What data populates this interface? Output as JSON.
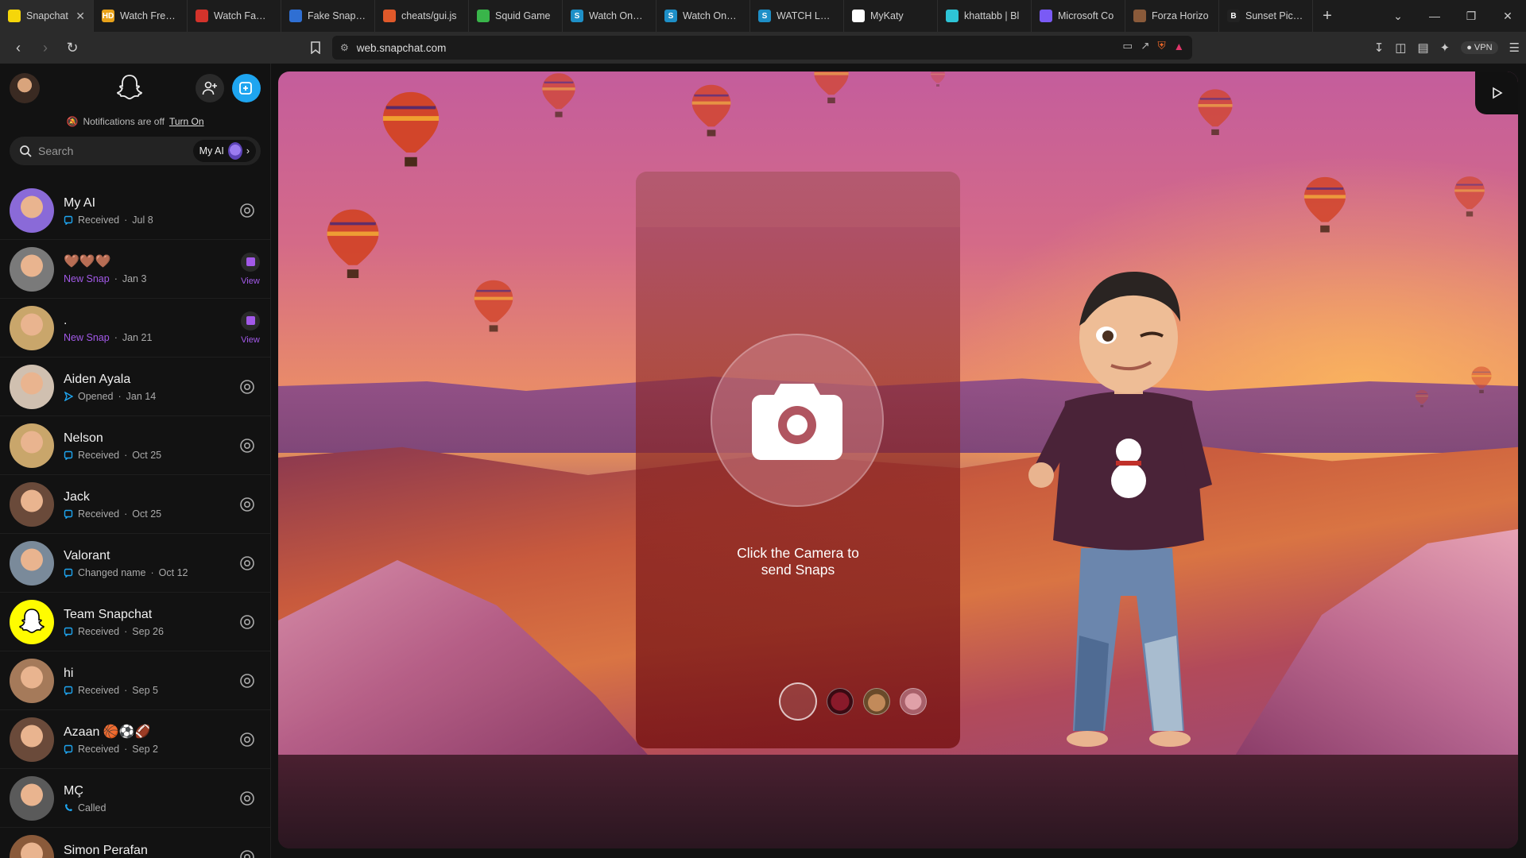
{
  "browser": {
    "tabs": [
      {
        "title": "Snapchat",
        "color": "#f5d60a",
        "letter": "",
        "active": true
      },
      {
        "title": "Watch Free B",
        "color": "#e8a21a",
        "letter": "HD",
        "active": false
      },
      {
        "title": "Watch Family",
        "color": "#d3332b",
        "letter": "",
        "active": false
      },
      {
        "title": "Fake Snapcha",
        "color": "#2f6fd3",
        "letter": "",
        "active": false
      },
      {
        "title": "cheats/gui.js",
        "color": "#e0592a",
        "letter": "",
        "active": false
      },
      {
        "title": "Squid Game",
        "color": "#39b54a",
        "letter": "",
        "active": false
      },
      {
        "title": "Watch One-P",
        "color": "#1e8fc7",
        "letter": "S",
        "active": false
      },
      {
        "title": "Watch One-P",
        "color": "#1e8fc7",
        "letter": "S",
        "active": false
      },
      {
        "title": "WATCH LEGO",
        "color": "#1e8fc7",
        "letter": "S",
        "active": false
      },
      {
        "title": "MyKaty",
        "color": "#ffffff",
        "letter": "",
        "active": false
      },
      {
        "title": "khattabb | Bl",
        "color": "#2ec4d6",
        "letter": "",
        "active": false
      },
      {
        "title": "Microsoft Co",
        "color": "#7a5af5",
        "letter": "",
        "active": false
      },
      {
        "title": "Forza Horizo",
        "color": "#8a5a3a",
        "letter": "",
        "active": false
      },
      {
        "title": "Sunset Pictur",
        "color": "#222222",
        "letter": "B",
        "active": false
      }
    ],
    "url": "web.snapchat.com",
    "vpn_label": "VPN"
  },
  "sidebar": {
    "notification_text": "Notifications are off",
    "notification_link": "Turn On",
    "search_placeholder": "Search",
    "my_ai_chip": "My AI",
    "chats": [
      {
        "name": "My AI",
        "status": "Received",
        "date": "Jul 8",
        "kind": "received",
        "action": "camera",
        "avatar": "#8a6ad8"
      },
      {
        "name": "🤎🤎🤎",
        "status": "New Snap",
        "date": "Jan 3",
        "kind": "new",
        "action": "view",
        "avatar": "#7a7a7a"
      },
      {
        "name": ".",
        "status": "New Snap",
        "date": "Jan 21",
        "kind": "new",
        "action": "view",
        "avatar": "#c9a66b"
      },
      {
        "name": "Aiden Ayala",
        "status": "Opened",
        "date": "Jan 14",
        "kind": "opened",
        "action": "camera",
        "avatar": "#d0c0b0"
      },
      {
        "name": "Nelson",
        "status": "Received",
        "date": "Oct 25",
        "kind": "received",
        "action": "camera",
        "avatar": "#c9a66b"
      },
      {
        "name": "Jack",
        "status": "Received",
        "date": "Oct 25",
        "kind": "received",
        "action": "camera",
        "avatar": "#6a4a3a"
      },
      {
        "name": "Valorant",
        "status": "Changed name",
        "date": "Oct 12",
        "kind": "received",
        "action": "camera",
        "avatar": "#7a8a9a"
      },
      {
        "name": "Team Snapchat",
        "status": "Received",
        "date": "Sep 26",
        "kind": "received",
        "action": "camera",
        "avatar": "#fffc00"
      },
      {
        "name": "hi",
        "status": "Received",
        "date": "Sep 5",
        "kind": "received",
        "action": "camera",
        "avatar": "#a57a5a"
      },
      {
        "name": "Azaan 🏀⚽🏈",
        "status": "Received",
        "date": "Sep 2",
        "kind": "received",
        "action": "camera",
        "avatar": "#6a4a3a"
      },
      {
        "name": "MÇ",
        "status": "Called",
        "date": "",
        "kind": "called",
        "action": "camera",
        "avatar": "#5a5a5a"
      },
      {
        "name": "Simon Perafan",
        "status": "",
        "date": "",
        "kind": "received",
        "action": "camera",
        "avatar": "#8a5a3a"
      }
    ]
  },
  "camera_panel": {
    "caption_line1": "Click the Camera to",
    "caption_line2": "send Snaps"
  },
  "colors": {
    "accent_blue": "#1ea5f0",
    "new_snap_purple": "#a259e8",
    "received_blue": "#1ea5f0",
    "snap_yellow": "#fffc00"
  }
}
